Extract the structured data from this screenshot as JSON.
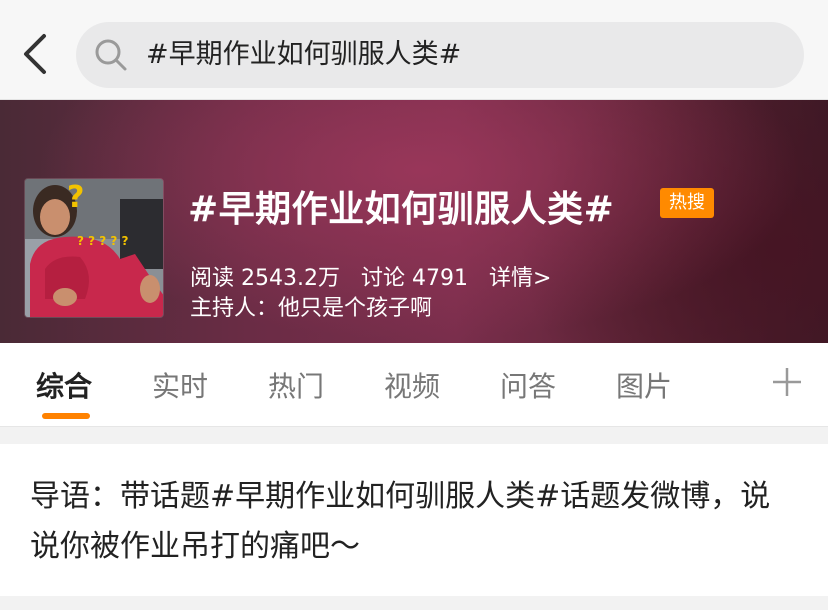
{
  "search": {
    "query": "#早期作业如何驯服人类#"
  },
  "topic": {
    "title": "#早期作业如何驯服人类#",
    "badge": "热搜",
    "reads": "阅读 2543.2万",
    "discussions": "讨论 4791",
    "details": "详情>",
    "host": "主持人：他只是个孩子啊",
    "avatar_caption": "? ? ? ? ?",
    "avatar_mark": "?"
  },
  "tabs": [
    {
      "label": "综合",
      "active": true
    },
    {
      "label": "实时"
    },
    {
      "label": "热门"
    },
    {
      "label": "视频"
    },
    {
      "label": "问答"
    },
    {
      "label": "图片"
    }
  ],
  "guide": {
    "text": "导语：带话题#早期作业如何驯服人类#话题发微博，说说你被作业吊打的痛吧～"
  },
  "colors": {
    "accent": "#ff8200",
    "hot_badge": "#ff8a00"
  }
}
